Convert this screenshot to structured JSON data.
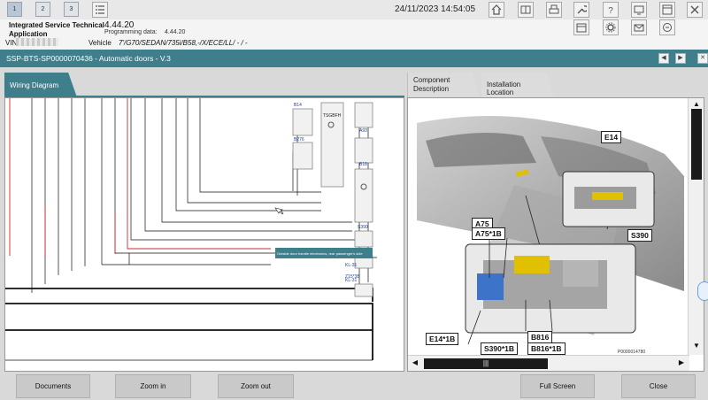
{
  "topbar": {
    "tabs": [
      "1",
      "2",
      "3"
    ],
    "datetime": "24/11/2023 14:54:05",
    "icons": [
      "list-icon",
      "home-icon",
      "book-icon",
      "printer-icon",
      "wrench-icon",
      "help-icon",
      "display-icon",
      "window-icon",
      "settings-icon",
      "mail-icon",
      "remote-icon"
    ]
  },
  "info": {
    "app_name": "Integrated Service Technical Application",
    "version": "4.44.20",
    "programming_label": "Programming data:",
    "programming_value": "4.44.20",
    "vin_label": "VIN",
    "vehicle_label": "Vehicle",
    "vehicle_value": "7'/G70/SEDAN/735i/B58,-/X/ECE/LL/ - / -"
  },
  "document": {
    "title": "SSP-BTS-SP0000070436 - Automatic doors - V.3"
  },
  "tabs": {
    "wiring": "Wiring Diagram",
    "component": "Component Description",
    "install": "Installation Location"
  },
  "wiring": {
    "labels": [
      "B14",
      "B276",
      "TSGBFH",
      "A93",
      "B18",
      "S390",
      "A75",
      "KL-31",
      "Z15*3B",
      "KL-31"
    ],
    "tooltip": "Outside door handle electronics, rear passenger's side"
  },
  "install": {
    "callouts": [
      "E14",
      "S390",
      "A75",
      "A75*1B",
      "E14*1B",
      "S390*1B",
      "B816",
      "B816*1B"
    ],
    "image_id": "P0000014780"
  },
  "buttons": {
    "documents": "Documents",
    "zoom_in": "Zoom in",
    "zoom_out": "Zoom out",
    "full_screen": "Full Screen",
    "close": "Close"
  }
}
